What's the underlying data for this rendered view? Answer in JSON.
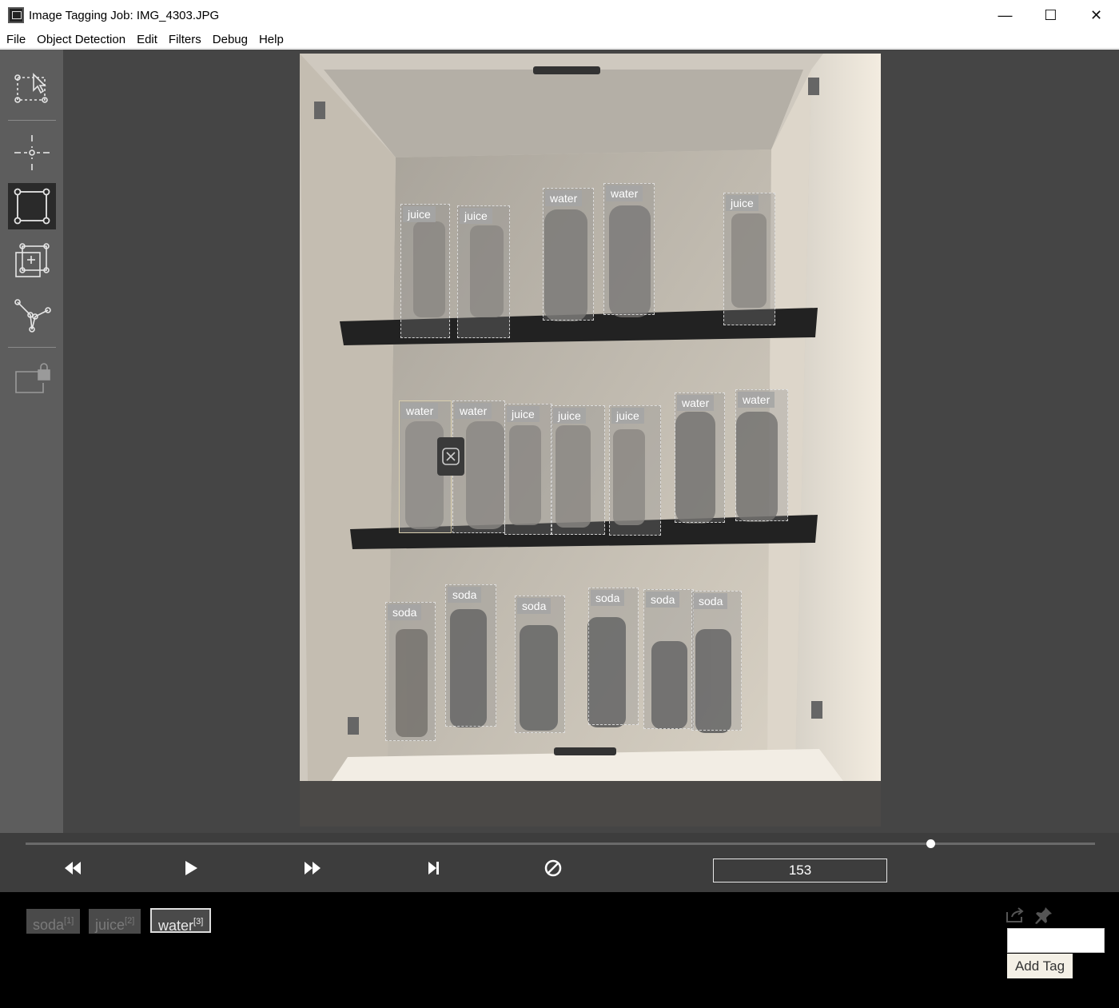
{
  "window": {
    "title": "Image Tagging Job: IMG_4303.JPG",
    "minimize": "—",
    "maximize": "☐",
    "close": "✕"
  },
  "menu": [
    "File",
    "Object Detection",
    "Edit",
    "Filters",
    "Debug",
    "Help"
  ],
  "tools": [
    {
      "name": "select-tool-icon"
    },
    {
      "name": "point-tool-icon"
    },
    {
      "name": "rectangle-tool-icon",
      "active": true
    },
    {
      "name": "copy-rectangle-tool-icon"
    },
    {
      "name": "polygon-tool-icon"
    },
    {
      "name": "lock-tool-icon"
    }
  ],
  "regions": [
    {
      "tag": "juice"
    },
    {
      "tag": "juice"
    },
    {
      "tag": "water"
    },
    {
      "tag": "water"
    },
    {
      "tag": "juice"
    },
    {
      "tag": "water",
      "selected": true
    },
    {
      "tag": "water"
    },
    {
      "tag": "juice"
    },
    {
      "tag": "juice"
    },
    {
      "tag": "juice"
    },
    {
      "tag": "water"
    },
    {
      "tag": "water"
    },
    {
      "tag": "soda"
    },
    {
      "tag": "soda"
    },
    {
      "tag": "soda"
    },
    {
      "tag": "soda"
    },
    {
      "tag": "soda"
    },
    {
      "tag": "soda"
    }
  ],
  "playback": {
    "frame": "153",
    "position_fraction": 0.846
  },
  "tags": [
    {
      "label": "soda",
      "hotkey": "[1]",
      "active": false
    },
    {
      "label": "juice",
      "hotkey": "[2]",
      "active": false
    },
    {
      "label": "water",
      "hotkey": "[3]",
      "active": true
    }
  ],
  "tag_input": {
    "value": "",
    "add_label": "Add Tag"
  }
}
